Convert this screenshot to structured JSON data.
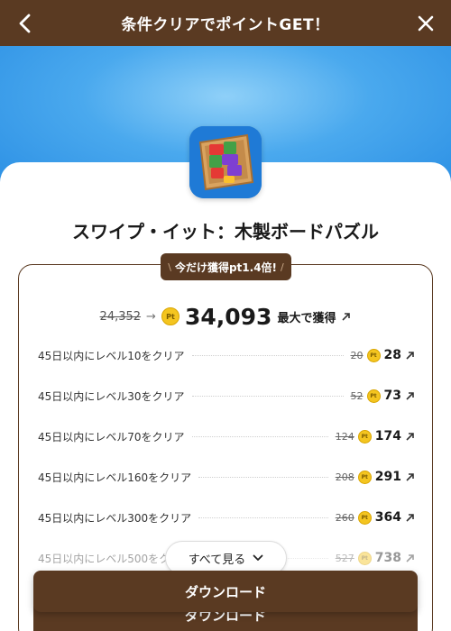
{
  "header": {
    "title": "条件クリアでポイントGET！"
  },
  "app": {
    "name": "スワイプ・イット：木製ボードパズル",
    "icon": "wooden-block-puzzle-icon"
  },
  "ribbon": {
    "label": "今だけ獲得pt1.4倍!"
  },
  "total": {
    "old_points": "24,352",
    "arrow": "→",
    "new_points": "34,093",
    "suffix": "最大で獲得"
  },
  "pt_mark": "Pt",
  "tasks": [
    {
      "label": "45日以内にレベル10をクリア",
      "old": "20",
      "new": "28"
    },
    {
      "label": "45日以内にレベル30をクリア",
      "old": "52",
      "new": "73"
    },
    {
      "label": "45日以内にレベル70をクリア",
      "old": "124",
      "new": "174"
    },
    {
      "label": "45日以内にレベル160をクリア",
      "old": "208",
      "new": "291"
    },
    {
      "label": "45日以内にレベル300をクリア",
      "old": "260",
      "new": "364"
    },
    {
      "label": "45日以内にレベル500をク",
      "old": "527",
      "new": "738"
    }
  ],
  "see_all": {
    "label": "すべて見る"
  },
  "download": {
    "label": "ダウンロード",
    "ghost_label": "ダウンロード"
  },
  "colors": {
    "brand_brown": "#5a3a22",
    "hero_blue": "#2b8fe4",
    "coin_gold": "#f4c520"
  }
}
